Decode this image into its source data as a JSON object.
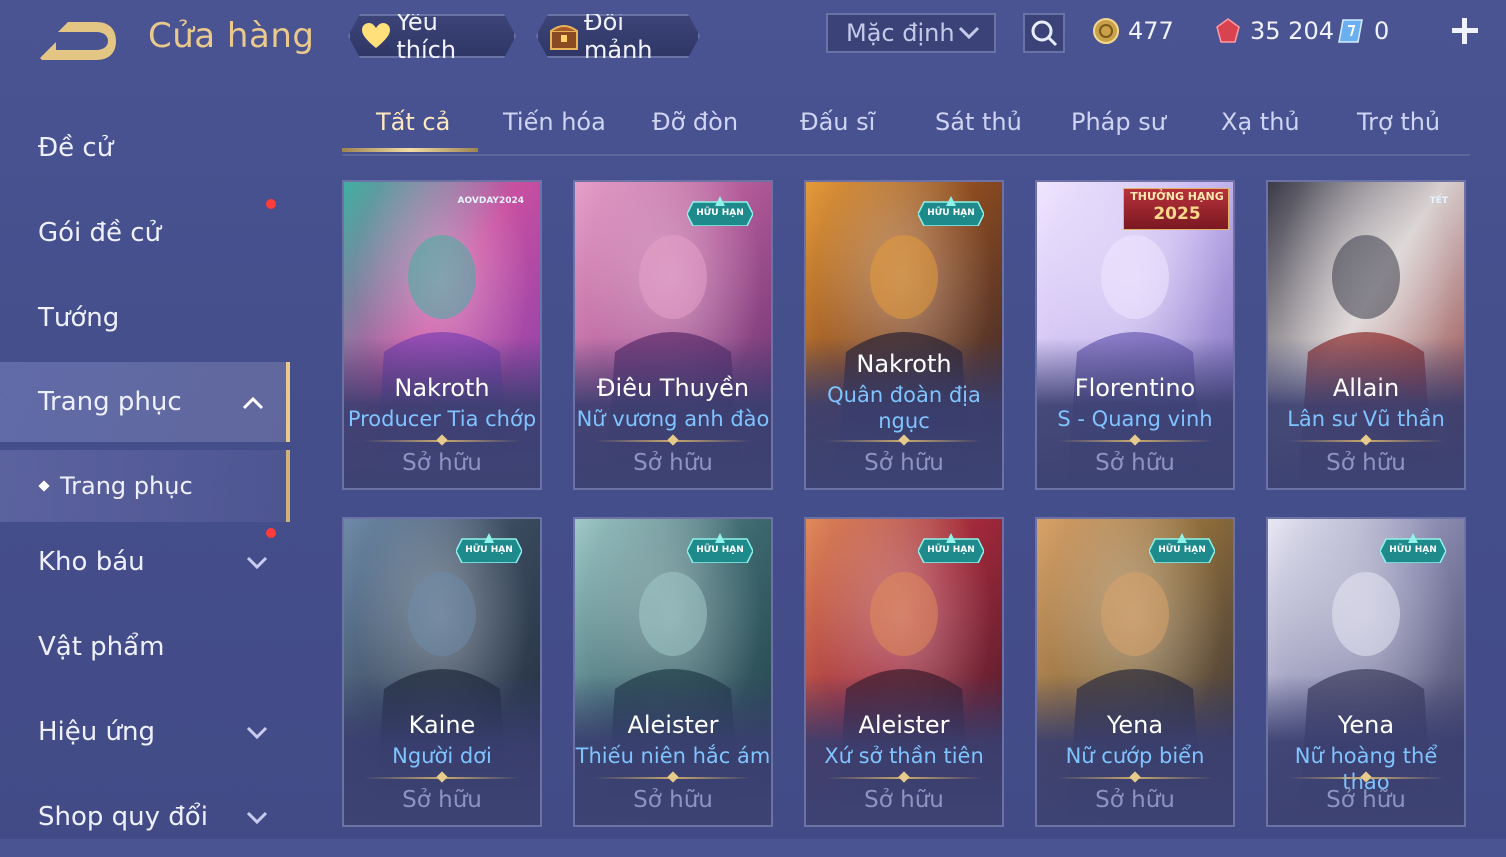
{
  "header": {
    "title": "Cửa hàng",
    "favorite_label": "Yêu thích",
    "shard_exchange_label": "Đổi mảnh",
    "sort_value": "Mặc định",
    "currencies": {
      "gold": "477",
      "gems": "35 204",
      "vouchers": "0"
    }
  },
  "sidebar": {
    "items": [
      {
        "label": "Đề cử"
      },
      {
        "label": "Gói đề cử"
      },
      {
        "label": "Tướng"
      },
      {
        "label": "Trang phục"
      },
      {
        "label": "Trang phục"
      },
      {
        "label": "Kho báu"
      },
      {
        "label": "Vật phẩm"
      },
      {
        "label": "Hiệu ứng"
      },
      {
        "label": "Shop quy đổi"
      }
    ]
  },
  "tabs": [
    "Tất cả",
    "Tiến hóa",
    "Đỡ đòn",
    "Đấu sĩ",
    "Sát thủ",
    "Pháp sư",
    "Xạ thủ",
    "Trợ thủ"
  ],
  "cards": [
    {
      "hero": "Nakroth",
      "skin": "Producer Tia chớp",
      "status": "Sở hữu",
      "badge": "AOVDAY2024",
      "colors": [
        "#7b3fb0",
        "#c94fa0",
        "#3fb0a0"
      ]
    },
    {
      "hero": "Điêu Thuyền",
      "skin": "Nữ vương anh đào",
      "status": "Sở hữu",
      "badge": "HỮU HẠN",
      "colors": [
        "#5a2a6a",
        "#b25a98",
        "#e6a0c8"
      ]
    },
    {
      "hero": "Nakroth",
      "skin": "Quân đoàn địa",
      "skin2": "ngục",
      "status": "Sở hữu",
      "badge": "HỮU HẠN",
      "colors": [
        "#2a2230",
        "#8a4a20",
        "#e49a3a"
      ]
    },
    {
      "hero": "Florentino",
      "skin": "S - Quang vinh",
      "status": "Sở hữu",
      "badge": "THƯỞNG HẠNG",
      "badge_year": "2025",
      "colors": [
        "#6a5ab0",
        "#c8b8f0",
        "#f0e6ff"
      ]
    },
    {
      "hero": "Allain",
      "skin": "Lân sư Vũ thần",
      "status": "Sở hữu",
      "badge": "TẾT",
      "colors": [
        "#8a2a2a",
        "#d8d0d0",
        "#3a3a48"
      ]
    },
    {
      "hero": "Kaine",
      "skin": "Người dơi",
      "status": "Sở hữu",
      "badge": "HỮU HẠN",
      "colors": [
        "#1e2a3a",
        "#3a4a5e",
        "#6e8aa8"
      ]
    },
    {
      "hero": "Aleister",
      "skin": "Thiếu niên hắc ám",
      "status": "Sở hữu",
      "badge": "HỮU HẠN",
      "colors": [
        "#1e3a44",
        "#3e6a70",
        "#a0c8c8"
      ]
    },
    {
      "hero": "Aleister",
      "skin": "Xứ sở thần tiên",
      "status": "Sở hữu",
      "badge": "HỮU HẠN",
      "colors": [
        "#3a1a2a",
        "#a0283a",
        "#e08a5a"
      ]
    },
    {
      "hero": "Yena",
      "skin": "Nữ cướp biển",
      "status": "Sở hữu",
      "badge": "HỮU HẠN",
      "colors": [
        "#2a2a38",
        "#8a6a3a",
        "#d8a26a"
      ]
    },
    {
      "hero": "Yena",
      "skin": "Nữ hoàng thể thao",
      "status": "Sở hữu",
      "badge": "HỮU HẠN",
      "colors": [
        "#3a3a5a",
        "#8a8ab0",
        "#e8e8f4"
      ]
    }
  ],
  "icons": {
    "back": "back-arrow-icon",
    "favorite": "heart-icon",
    "shard": "treasure-chest-icon",
    "search": "search-icon",
    "gold": "gold-coin-icon",
    "gem": "ruby-gem-icon",
    "voucher": "voucher-icon",
    "add": "plus-icon"
  },
  "colors": {
    "accent_gold": "#e9c98c",
    "skin_name": "#7fc3ff",
    "notification": "#ff3b3b"
  }
}
